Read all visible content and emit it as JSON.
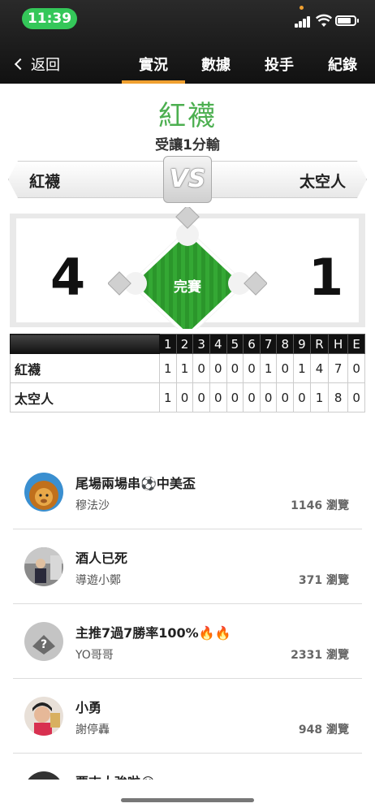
{
  "status_bar": {
    "time": "11:39"
  },
  "nav": {
    "back_label": "返回",
    "tabs": [
      {
        "label": "實況",
        "active": true
      },
      {
        "label": "數據",
        "active": false
      },
      {
        "label": "投手",
        "active": false
      },
      {
        "label": "紀錄",
        "active": false
      }
    ]
  },
  "game": {
    "pick_team": "紅襪",
    "handicap_text": "受讓1分輸",
    "away_team": "紅襪",
    "home_team": "太空人",
    "vs_label": "VS",
    "away_score": "4",
    "home_score": "1",
    "status": "完賽"
  },
  "linescore": {
    "headers": [
      "1",
      "2",
      "3",
      "4",
      "5",
      "6",
      "7",
      "8",
      "9",
      "R",
      "H",
      "E"
    ],
    "rows": [
      {
        "team": "紅襪",
        "values": [
          "1",
          "1",
          "0",
          "0",
          "0",
          "0",
          "1",
          "0",
          "1",
          "4",
          "7",
          "0"
        ]
      },
      {
        "team": "太空人",
        "values": [
          "1",
          "0",
          "0",
          "0",
          "0",
          "0",
          "0",
          "0",
          "0",
          "1",
          "8",
          "0"
        ]
      }
    ]
  },
  "articles": [
    {
      "title": "尾場兩場串⚽中美盃",
      "author": "穆法沙",
      "views": "1146 瀏覽",
      "avatar_icon": "lion-avatar"
    },
    {
      "title": "酒人已死",
      "author": "導遊小鄭",
      "views": "371 瀏覽",
      "avatar_icon": "photo-avatar"
    },
    {
      "title": "主推7過7勝率100%🔥🔥",
      "author": "YO哥哥",
      "views": "2331 瀏覽",
      "avatar_icon": "default-avatar"
    },
    {
      "title": "小勇",
      "author": "謝停轟",
      "views": "948 瀏覽",
      "avatar_icon": "person-avatar"
    },
    {
      "title": "要吉大強啦😂",
      "author": "",
      "views": "",
      "avatar_icon": "partial-avatar"
    }
  ],
  "colors": {
    "accent": "#f0a030",
    "team_green": "#4caf50",
    "field_green": "#2e9e2e"
  }
}
